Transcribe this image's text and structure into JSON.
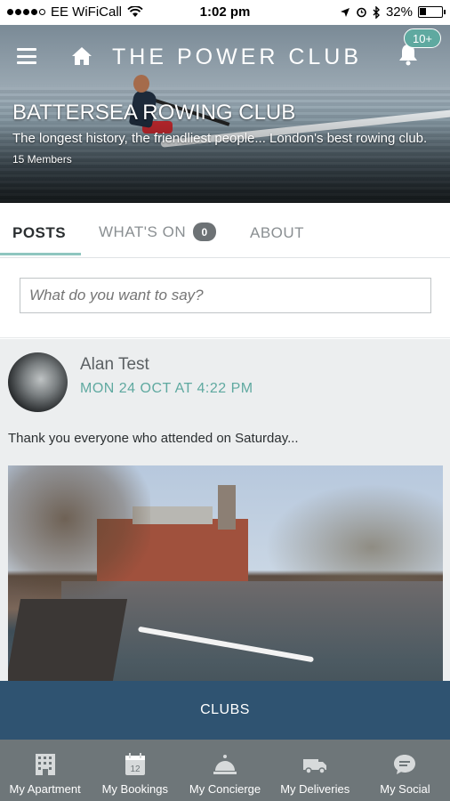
{
  "status_bar": {
    "carrier": "EE WiFiCall",
    "time": "1:02 pm",
    "battery": "32%",
    "battery_level": 0.32
  },
  "header": {
    "brand": "THE POWER CLUB",
    "notifications_badge": "10+"
  },
  "club": {
    "name": "BATTERSEA ROWING CLUB",
    "description": "The longest history, the friendliest people... London's best rowing club.",
    "members": "15 Members"
  },
  "tabs": [
    {
      "label": "POSTS",
      "active": true
    },
    {
      "label": "WHAT'S ON",
      "count": "0"
    },
    {
      "label": "ABOUT"
    }
  ],
  "composer": {
    "placeholder": "What do you want to say?"
  },
  "post": {
    "author": "Alan Test",
    "timestamp": "MON 24 OCT AT 4:22 PM",
    "text": "Thank you everyone who attended on Saturday..."
  },
  "clubs_button": "CLUBS",
  "bottom_nav": [
    {
      "label": "My Apartment",
      "icon": "building-icon"
    },
    {
      "label": "My Bookings",
      "icon": "calendar-icon"
    },
    {
      "label": "My Concierge",
      "icon": "service-bell-icon"
    },
    {
      "label": "My Deliveries",
      "icon": "truck-icon"
    },
    {
      "label": "My Social",
      "icon": "chat-bubble-icon"
    }
  ],
  "colors": {
    "accent": "#5fa9a0",
    "clubs_bar": "#2f5371",
    "bottom_nav": "#6e7679"
  }
}
